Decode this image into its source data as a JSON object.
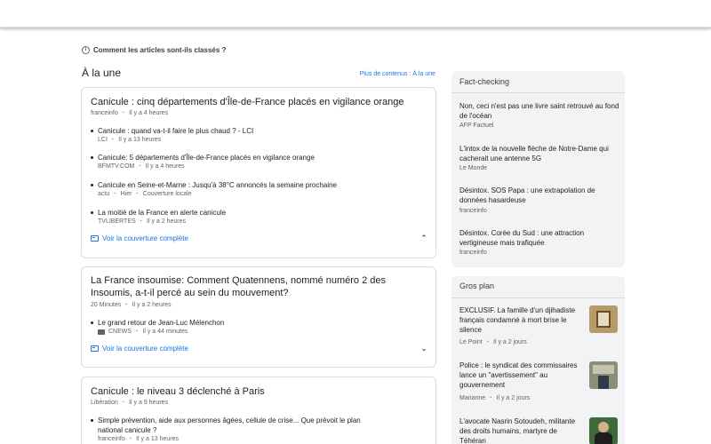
{
  "how_ranked": {
    "icon": "info-icon",
    "label": "Comment les articles sont-ils classés ?"
  },
  "top_stories": {
    "title": "À la une",
    "more_link": "Plus de contenus : À la une",
    "cards": [
      {
        "headline": "Canicule : cinq départements d'Île-de-France placés en vigilance orange",
        "source": "franceinfo",
        "time": "Il y a 4 heures",
        "sub_articles": [
          {
            "title": "Canicule : quand va-t-il faire le plus chaud ? - LCI",
            "source": "LCI",
            "time": "Il y a 13 heures"
          },
          {
            "title": "Canicule: 5 départements d'Île-de-France placés en vigilance orange",
            "source": "BFMTV.COM",
            "time": "Il y a 4 heures"
          },
          {
            "title": "Canicule en Seine-et-Marne : Jusqu'à 38°C annoncés la semaine prochaine",
            "source": "actu",
            "time": "Hier",
            "tag": "Couverture locale"
          },
          {
            "title": "La moitié de la France en alerte canicule",
            "source": "TVLIBERTES",
            "time": "Il y a 2 heures"
          }
        ],
        "coverage_label": "Voir la couverture complète",
        "chevron": "chevron-up-icon"
      },
      {
        "headline": "La France insoumise: Comment Quatennens, nommé numéro 2 des Insoumis, a-t-il percé au sein du mouvement?",
        "source": "20 Minutes",
        "time": "Il y a 2 heures",
        "sub_articles": [
          {
            "title": "Le grand retour de Jean-Luc Mélenchon",
            "source": "CNEWS",
            "time": "Il y a 44 minutes",
            "source_icon": "video-icon"
          }
        ],
        "coverage_label": "Voir la couverture complète",
        "chevron": "chevron-down-icon"
      },
      {
        "headline": "Canicule : le niveau 3 déclenché à Paris",
        "source": "Libération",
        "time": "Il y a 9 heures",
        "sub_articles": [
          {
            "title": "Simple prévention, aide aux personnes âgées, cellule de crise... Que prévoit le plan national canicule ?",
            "source": "franceinfo",
            "time": "Il y a 13 heures"
          }
        ]
      }
    ]
  },
  "fact_checking": {
    "title": "Fact-checking",
    "items": [
      {
        "title": "Non, ceci n'est pas une livre saint retrouvé au fond de l'océan",
        "source": "AFP Factuel"
      },
      {
        "title": "L'intox de la nouvelle flèche de Notre-Dame qui cacherait une antenne 5G",
        "source": "Le Monde"
      },
      {
        "title": "Désintox. SOS Papa : une extrapolation de données hasardeuse",
        "source": "franceinfo"
      },
      {
        "title": "Désintox. Corée du Sud : une attraction vertigineuse mais trafiquée",
        "source": "franceinfo"
      }
    ]
  },
  "gros_plan": {
    "title": "Gros plan",
    "items": [
      {
        "title": "EXCLUSIF. La famille d'un djihadiste français condamné à mort brise le silence",
        "source": "Le Point",
        "time": "Il y a 2 jours",
        "thumb_color": "#b89a6a"
      },
      {
        "title": "Police : le syndicat des commissaires lance un \"avertissement\" au gouvernement",
        "source": "Marianne",
        "time": "Il y a 2 jours",
        "thumb_color": "#8a8f7a"
      },
      {
        "title": "L'avocate Nasrin Sotoudeh, militante des droits humains, martyre de Téhéran",
        "source": "",
        "time": "",
        "thumb_color": "#3f6b3a"
      }
    ]
  }
}
